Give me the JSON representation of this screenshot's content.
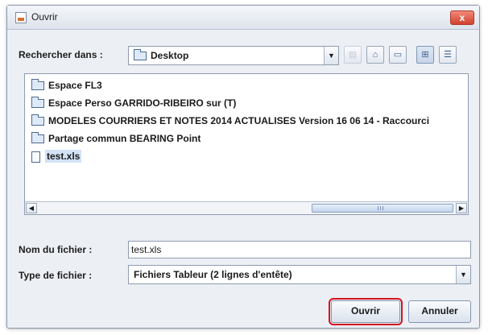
{
  "window": {
    "title": "Ouvrir",
    "close_label": "x"
  },
  "look_in": {
    "label": "Rechercher dans :",
    "value": "Desktop"
  },
  "toolbar": {
    "buttons": [
      "up-one-level",
      "home-folder",
      "new-folder",
      "list-view",
      "details-view"
    ]
  },
  "files": [
    {
      "name": "Espace FL3",
      "type": "folder"
    },
    {
      "name": "Espace Perso GARRIDO-RIBEIRO sur (T)",
      "type": "folder"
    },
    {
      "name": "MODELES COURRIERS ET NOTES 2014 ACTUALISES Version 16 06 14 - Raccourci",
      "type": "folder"
    },
    {
      "name": "Partage commun BEARING Point",
      "type": "folder"
    },
    {
      "name": "test.xls",
      "type": "file",
      "selected": true
    }
  ],
  "filename": {
    "label": "Nom du fichier :",
    "value": "test.xls"
  },
  "filetype": {
    "label": "Type de fichier :",
    "value": "Fichiers Tableur (2 lignes d'entête)"
  },
  "buttons": {
    "open": "Ouvrir",
    "cancel": "Annuler"
  },
  "colors": {
    "accent_highlight": "#d4141e",
    "selection": "#d3e2f6"
  }
}
